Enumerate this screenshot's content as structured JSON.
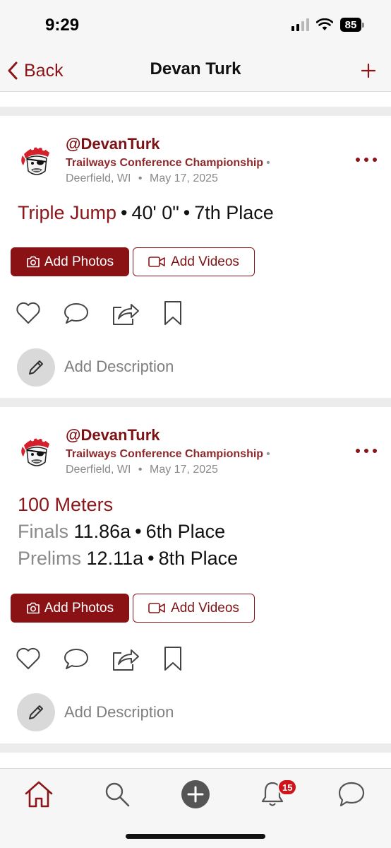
{
  "status_bar": {
    "time": "9:29",
    "battery": "85"
  },
  "nav": {
    "back_label": "Back",
    "title": "Devan Turk",
    "plus_icon": "plus-icon"
  },
  "colors": {
    "brand": "#8b1518",
    "button_fill": "#8a1214",
    "muted": "#8a8a8a",
    "badge": "#d0121b"
  },
  "posts": [
    {
      "handle": "@DevanTurk",
      "meet": "Trailways Conference Championship",
      "meet_sep": "•",
      "location": "Deerfield, WI",
      "date_sep": "•",
      "date": "May 17, 2025",
      "event": "Triple Jump",
      "sep1": "•",
      "mark": "40' 0\"",
      "sep2": "•",
      "place": "7th Place",
      "add_photos": "Add Photos",
      "add_videos": "Add Videos",
      "add_description": "Add Description"
    },
    {
      "handle": "@DevanTurk",
      "meet": "Trailways Conference Championship",
      "meet_sep": "•",
      "location": "Deerfield, WI",
      "date_sep": "•",
      "date": "May 17, 2025",
      "event": "100 Meters",
      "rounds": [
        {
          "label": "Finals",
          "mark": "11.86a",
          "sep": "•",
          "place": "6th Place"
        },
        {
          "label": "Prelims",
          "mark": "12.11a",
          "sep": "•",
          "place": "8th Place"
        }
      ],
      "add_photos": "Add Photos",
      "add_videos": "Add Videos",
      "add_description": "Add Description"
    }
  ],
  "tab_bar": {
    "items": [
      "home-icon",
      "search-icon",
      "add-circle-icon",
      "bell-icon",
      "chat-icon"
    ],
    "notification_count": "15"
  }
}
